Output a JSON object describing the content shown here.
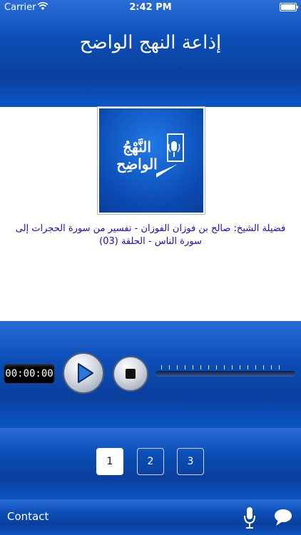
{
  "status_bar": {
    "carrier": "Carrier",
    "time": "2:42 PM"
  },
  "header": {
    "title": "إذاعة النهج الواضح"
  },
  "logo": {
    "text_line1": "النَّهْجُ",
    "text_line2": "الواضِح"
  },
  "episode": {
    "description": "فضيلة الشيخ: صالح بن فوزان الفوزان - تفسير من سورة الحجرات إلى سورة الناس - الحلقة (03)"
  },
  "player": {
    "elapsed": "00:00:00",
    "progress": 0
  },
  "pagination": {
    "pages": [
      "1",
      "2",
      "3"
    ],
    "active": "1"
  },
  "bottom_bar": {
    "contact_label": "Contact"
  },
  "colors": {
    "accent_blue": "#0b4ab2",
    "description_text": "#1a0cc8"
  }
}
